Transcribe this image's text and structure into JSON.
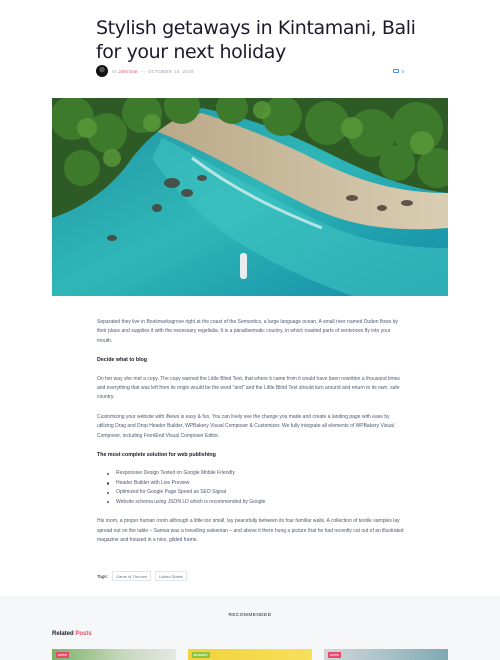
{
  "article": {
    "title": "Stylish getaways in Kintamani, Bali for your next holiday",
    "by": "By",
    "author": "John Doe",
    "separator": "—",
    "date": "OCTOBER 15, 2018",
    "comment_count": "0"
  },
  "content": {
    "p1": "Separated they live in Bookmarksgrove right at the coast of the Semantics, a large language ocean. A small river named Duden flows by their place and supplies it with the necessary regelialia. It is a paradisematic country, in which roasted parts of sentences fly into your mouth.",
    "h1": "Decide what to blog",
    "p2": "On her way she met a copy. The copy warned the Little Blind Text, that where it came from it would have been rewritten a thousand times and everything that was left from its origin would be the word \"and\" and the Little Blind Text should turn around and return to its own, safe country.",
    "p3": "Customizing your website with iNews is easy & fun. You can lively see the change you made and create a landing page with ease by utilizing Drag and Drop Header Builder, WPBakery Visual Composer & Customizer. We fully integrate all elements of WPBakery Visual Composer, including FrontEnd Visual Composer Editor.",
    "h2": "The most complete solution for web publishing",
    "list": [
      "Responsive Design Tested on Google Mobile Friendly",
      "Header Builder with Live Preview",
      "Optimized for Google Page Speed as SEO Signal",
      "Website schema using JSON LD which is recommended by Google"
    ],
    "p4": "His room, a proper human room although a little too small, lay peacefully between its four familiar walls. A collection of textile samples lay spread out on the table – Samsa was a travelling salesman – and above it there hung a picture that he had recently cut out of an illustrated magazine and housed in a nice, gilded frame."
  },
  "tags": {
    "label": "Tags:",
    "items": [
      "Game of Thrones",
      "United States"
    ]
  },
  "recommended": {
    "title": "RECOMMENDED",
    "related_prefix": "Related",
    "related_accent": "Posts",
    "cards": [
      {
        "badge": "APPS",
        "badge_color": "#e94b6a"
      },
      {
        "badge": "BUDGET",
        "badge_color": "#8cc63f"
      },
      {
        "badge": "APPS",
        "badge_color": "#e94b6a"
      }
    ]
  },
  "colors": {
    "accent": "#e94b6a",
    "link": "#4a90e2",
    "heading": "#1b1b2c"
  }
}
